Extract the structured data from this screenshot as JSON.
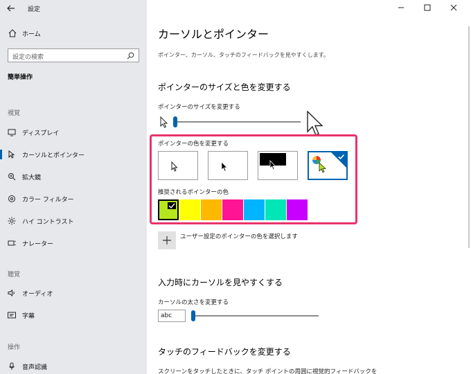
{
  "window": {
    "title": "設定"
  },
  "sidebar": {
    "home": "ホーム",
    "search_placeholder": "設定の検索",
    "section": "簡単操作",
    "groups": [
      {
        "heading": "視覚",
        "items": [
          "ディスプレイ",
          "カーソルとポインター",
          "拡大鏡",
          "カラー フィルター",
          "ハイ コントラスト",
          "ナレーター"
        ]
      },
      {
        "heading": "聴覚",
        "items": [
          "オーディオ",
          "字幕"
        ]
      },
      {
        "heading": "操作",
        "items": [
          "音声認識"
        ]
      }
    ],
    "active_item": "カーソルとポインター"
  },
  "main": {
    "title": "カーソルとポインター",
    "description": "ポインター、カーソル、タッチのフィードバックを見やすくします。",
    "pointer_section": {
      "heading": "ポインターのサイズと色を変更する",
      "size_label": "ポインターのサイズを変更する",
      "size_value": 1,
      "color_label": "ポインターの色を変更する",
      "color_options": [
        "white",
        "black",
        "inverted",
        "custom"
      ],
      "selected_color_option": "custom",
      "suggested_label": "推奨されるポインターの色",
      "suggested_colors": [
        "#b6e51e",
        "#ffff00",
        "#ffb800",
        "#ff1493",
        "#00b4ff",
        "#00e6b4",
        "#c800ff"
      ],
      "selected_suggested": "#b6e51e",
      "custom_label": "ユーザー設定のポインターの色を選択します"
    },
    "cursor_section": {
      "heading": "入力時にカーソルを見やすくする",
      "thickness_label": "カーソルの太さを変更する",
      "preview_text": "abc",
      "thickness_value": 1
    },
    "touch_section": {
      "heading": "タッチのフィードバックを変更する",
      "text": "スクリーンをタッチしたときに、タッチ ポイントの周囲に視覚的フィードバックを"
    }
  },
  "colors": {
    "accent": "#0063b1",
    "highlight": "#e8336b",
    "sidebar_bg": "#e6e8eb"
  }
}
